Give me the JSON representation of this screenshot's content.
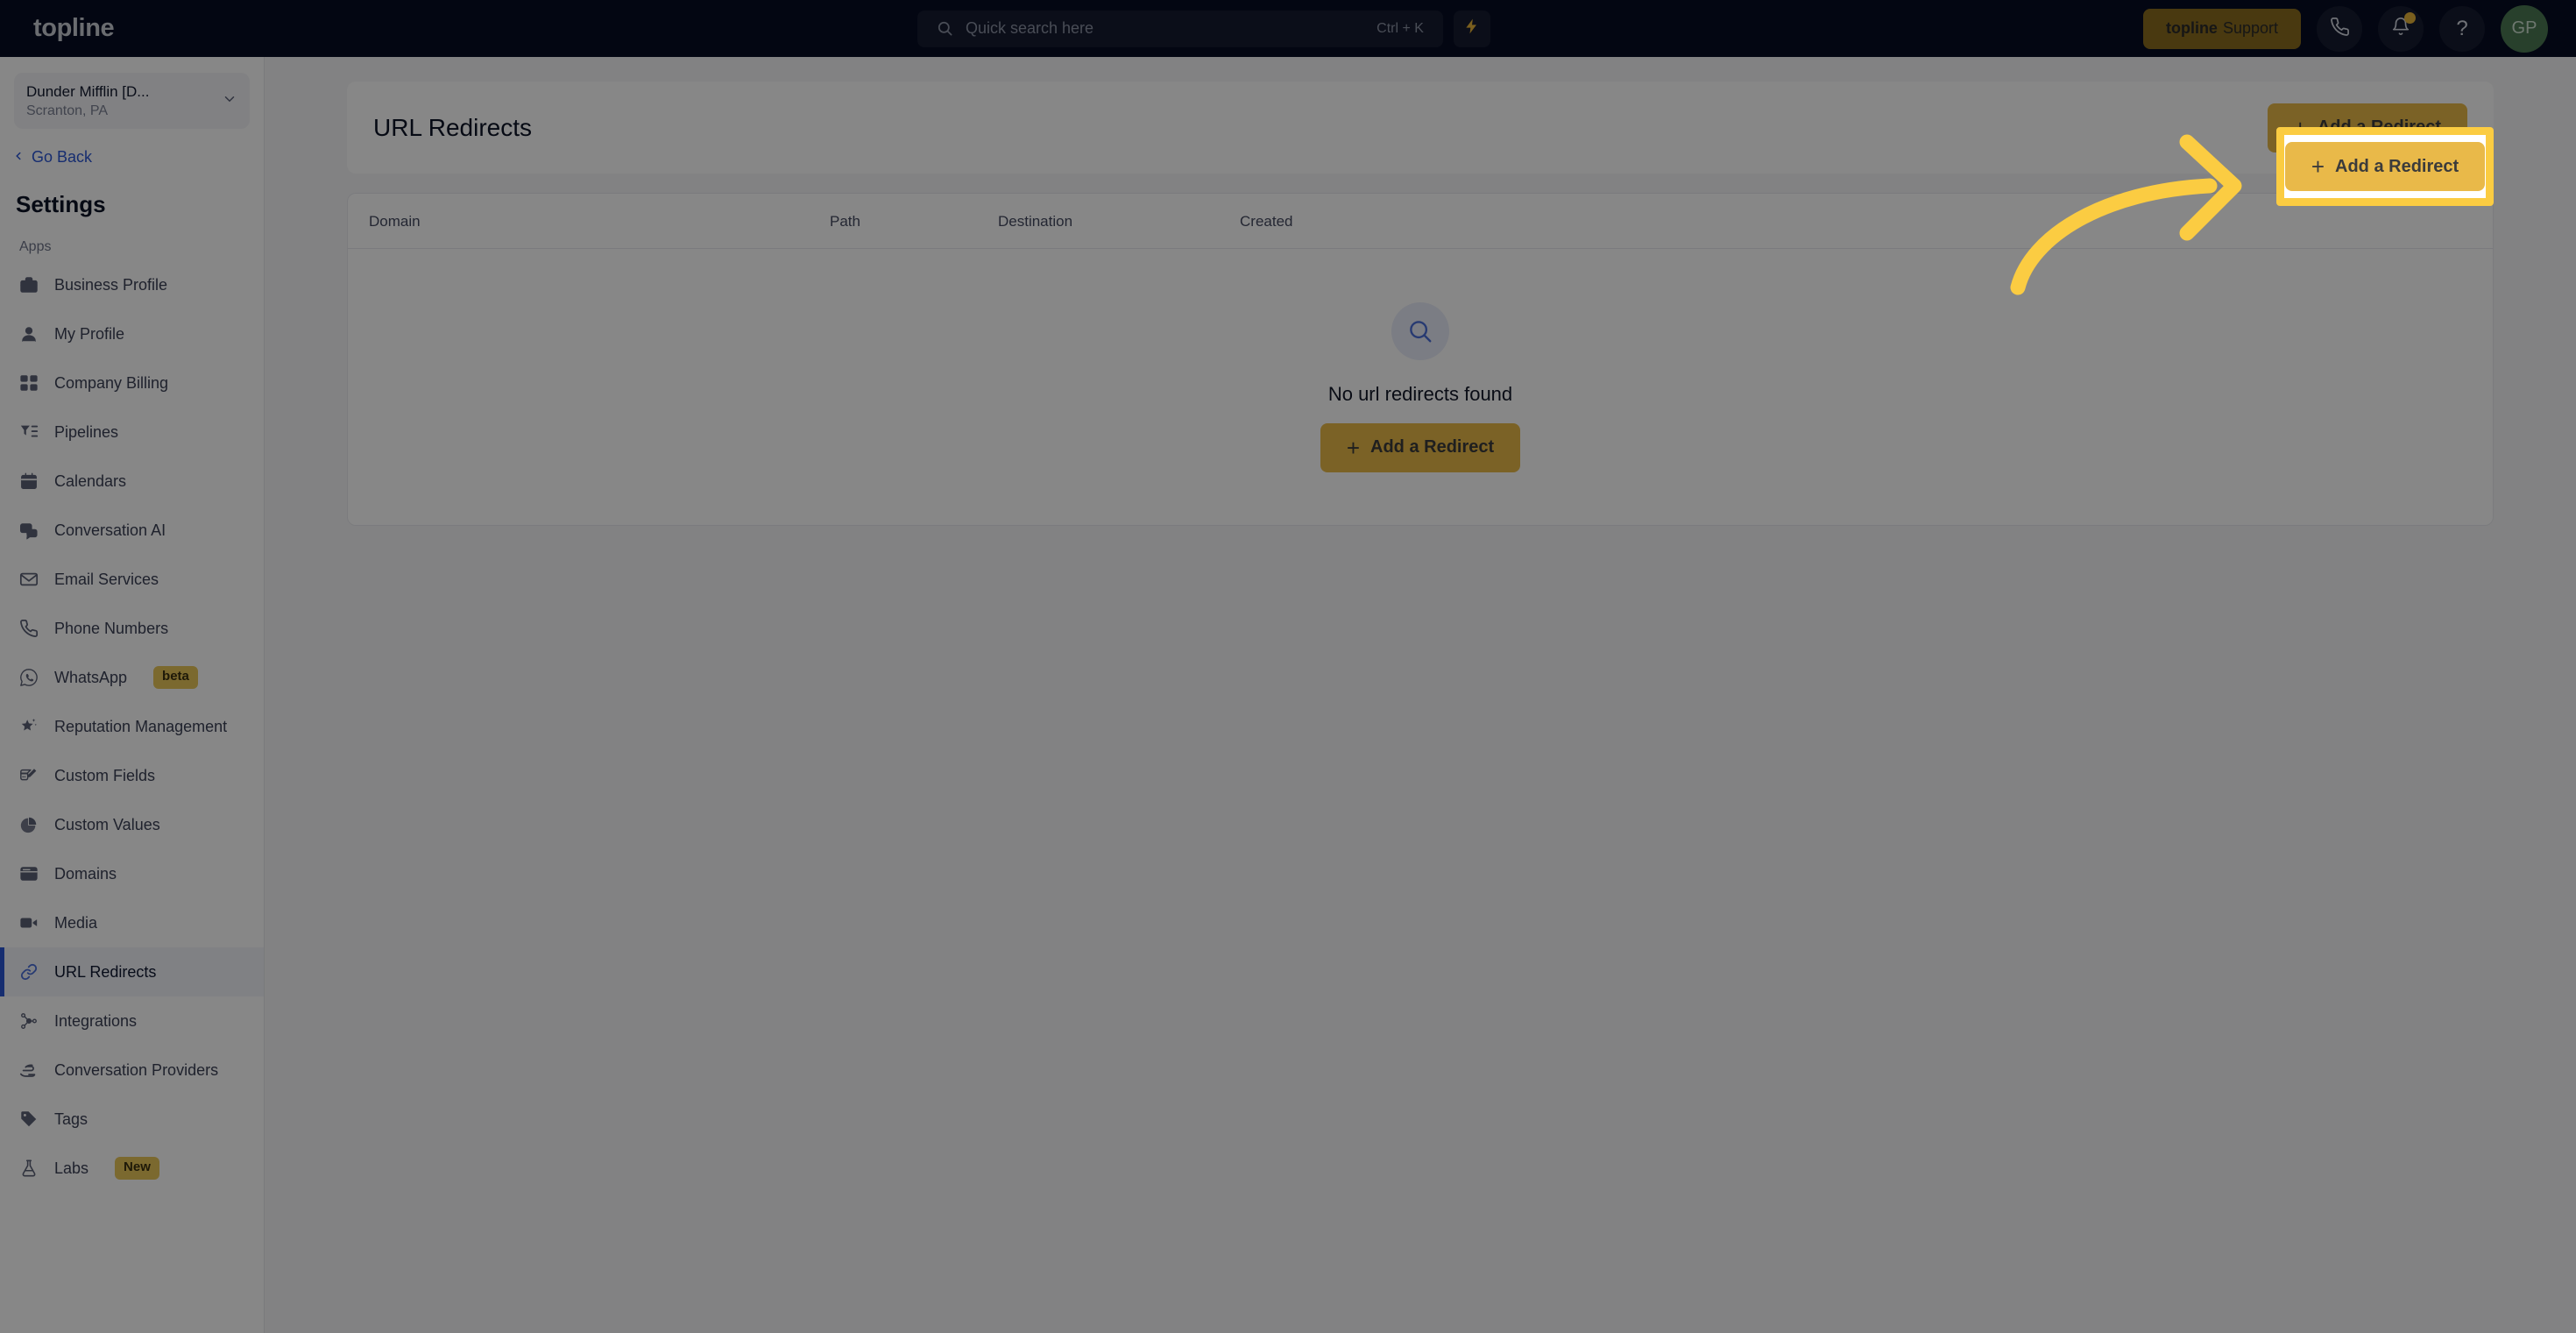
{
  "topbar": {
    "brand": "topline",
    "search": {
      "placeholder": "Quick search here",
      "shortcut": "Ctrl + K",
      "icon": "search-icon"
    },
    "bolt_icon": "lightning-bolt-icon",
    "support_button": {
      "brand": "topline",
      "label": "Support"
    },
    "phone_icon": "phone-icon",
    "notifications_icon": "bell-icon",
    "help_icon": "question-mark-icon",
    "avatar_initials": "GP"
  },
  "sidebar": {
    "location": {
      "name": "Dunder Mifflin [D...",
      "sub": "Scranton, PA",
      "chevron_icon": "chevron-down-icon"
    },
    "go_back": {
      "label": "Go Back",
      "icon": "chevron-left-icon"
    },
    "title": "Settings",
    "group_label": "Apps",
    "items": [
      {
        "label": "Business Profile",
        "icon": "briefcase-icon",
        "active": false
      },
      {
        "label": "My Profile",
        "icon": "person-icon",
        "active": false
      },
      {
        "label": "Company Billing",
        "icon": "calculator-icon",
        "active": false
      },
      {
        "label": "Pipelines",
        "icon": "funnel-list-icon",
        "active": false
      },
      {
        "label": "Calendars",
        "icon": "calendar-icon",
        "active": false
      },
      {
        "label": "Conversation AI",
        "icon": "chat-bubbles-icon",
        "active": false
      },
      {
        "label": "Email Services",
        "icon": "envelope-icon",
        "active": false
      },
      {
        "label": "Phone Numbers",
        "icon": "phone-icon",
        "active": false
      },
      {
        "label": "WhatsApp",
        "icon": "whatsapp-icon",
        "active": false,
        "badge": "beta"
      },
      {
        "label": "Reputation Management",
        "icon": "star-sparkle-icon",
        "active": false
      },
      {
        "label": "Custom Fields",
        "icon": "field-edit-icon",
        "active": false
      },
      {
        "label": "Custom Values",
        "icon": "pie-chart-icon",
        "active": false
      },
      {
        "label": "Domains",
        "icon": "browser-window-icon",
        "active": false
      },
      {
        "label": "Media",
        "icon": "video-camera-icon",
        "active": false
      },
      {
        "label": "URL Redirects",
        "icon": "link-chain-icon",
        "active": true
      },
      {
        "label": "Integrations",
        "icon": "nodes-icon",
        "active": false
      },
      {
        "label": "Conversation Providers",
        "icon": "hand-message-icon",
        "active": false
      },
      {
        "label": "Tags",
        "icon": "tag-icon",
        "active": false
      },
      {
        "label": "Labs",
        "icon": "flask-icon",
        "active": false,
        "badge": "New"
      }
    ]
  },
  "main": {
    "page_title": "URL Redirects",
    "add_button_label": "Add a Redirect",
    "add_button_plus": "+",
    "table": {
      "columns": [
        "Domain",
        "Path",
        "Destination",
        "Created"
      ]
    },
    "empty_state": {
      "icon": "search-icon",
      "message": "No url redirects found",
      "button_label": "Add a Redirect",
      "button_plus": "+"
    }
  },
  "annotation": {
    "arrow": "curved-arrow-right",
    "highlight_target": "Add a Redirect"
  },
  "colors": {
    "topbar_bg": "#070D22",
    "accent_yellow": "#e9b949",
    "annotation_yellow": "#fbcc42",
    "active_blue": "#2b55d4",
    "avatar_green": "#4c7a53",
    "badge_yellow": "#e9c75a"
  }
}
